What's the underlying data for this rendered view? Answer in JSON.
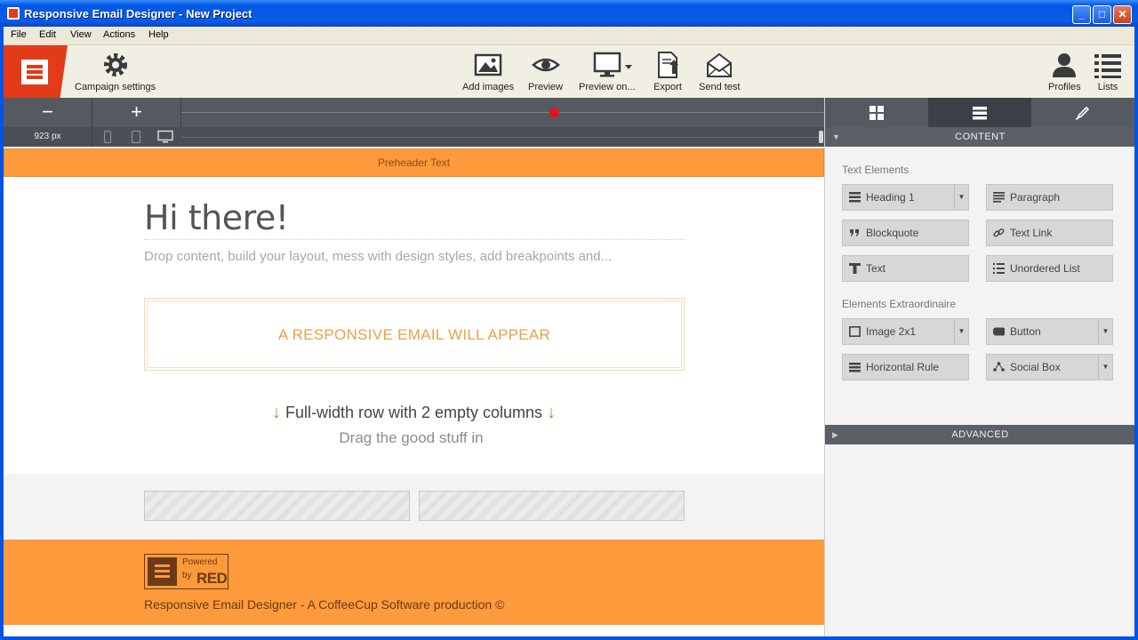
{
  "window": {
    "title": "Responsive Email Designer - New Project",
    "minimize": "_",
    "maximize": "□",
    "close": "✕"
  },
  "menu": [
    "File",
    "Edit",
    "View",
    "Actions",
    "Help"
  ],
  "toolbar": {
    "campaign_settings": "Campaign settings",
    "add_images": "Add images",
    "preview": "Preview",
    "preview_on": "Preview on...",
    "export": "Export",
    "send_test": "Send test",
    "profiles": "Profiles",
    "lists": "Lists"
  },
  "controls": {
    "zoom_out": "−",
    "zoom_in": "+",
    "width_readout": "923 px"
  },
  "canvas": {
    "preheader": "Preheader Text",
    "heading": "Hi there!",
    "intro": "Drop content, build your layout, mess with design styles, add breakpoints and...",
    "placeholder_box": "A RESPONSIVE EMAIL WILL APPEAR",
    "row_arrow": "↓",
    "row_title": "Full-width row with 2 empty columns",
    "row_subtitle": "Drag the good stuff in",
    "badge_powered": "Powered",
    "badge_by": "by",
    "badge_red": "RED",
    "footer_text": "Responsive Email Designer - A CoffeeCup Software production ©"
  },
  "panel": {
    "content_header": "CONTENT",
    "text_elements_label": "Text Elements",
    "extraordinaire_label": "Elements Extraordinaire",
    "advanced_header": "ADVANCED",
    "text_elements": {
      "heading": "Heading 1",
      "paragraph": "Paragraph",
      "blockquote": "Blockquote",
      "text_link": "Text Link",
      "text": "Text",
      "unordered_list": "Unordered List"
    },
    "extra_elements": {
      "image": "Image 2x1",
      "button": "Button",
      "horizontal_rule": "Horizontal Rule",
      "social_box": "Social Box"
    }
  },
  "colors": {
    "brand_red": "#e23b1a",
    "brand_orange": "#fd9a3b",
    "slider_dot": "#e8121b"
  }
}
